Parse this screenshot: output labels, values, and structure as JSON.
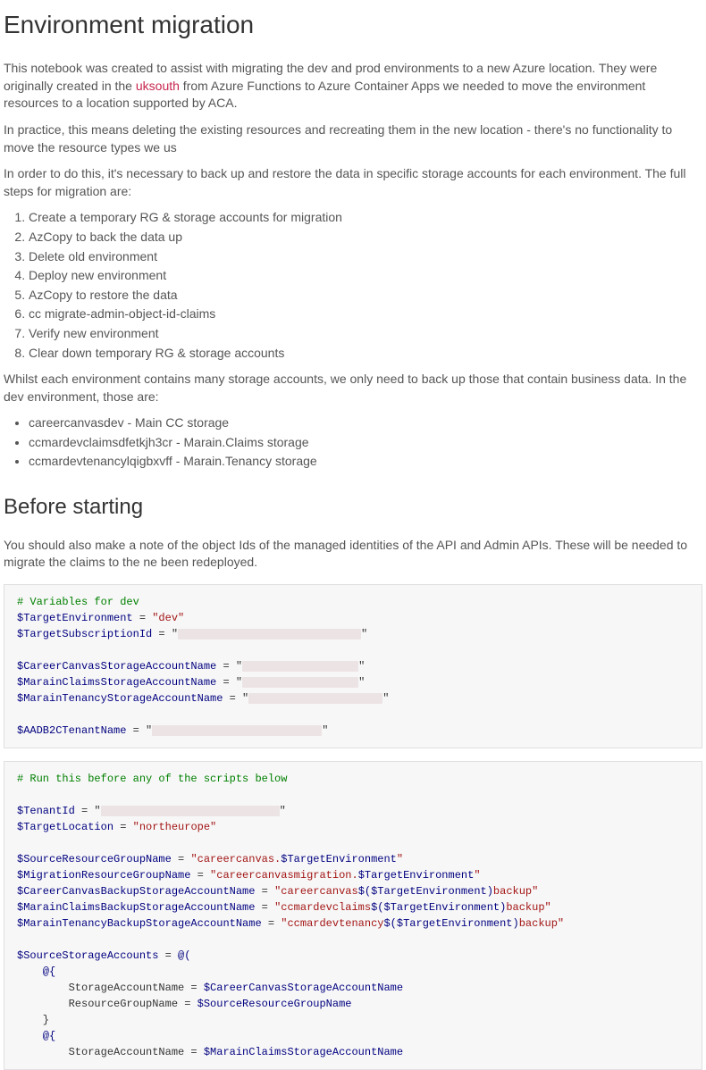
{
  "h1": "Environment migration",
  "p1_a": "This notebook was created to assist with migrating the dev and prod environments to a new Azure location. They were originally created in the ",
  "p1_region": "uksouth",
  "p1_b": " from Azure Functions to Azure Container Apps we needed to move the environment resources to a location supported by ACA.",
  "p2": "In practice, this means deleting the existing resources and recreating them in the new location - there's no functionality to move the resource types we us",
  "p3": "In order to do this, it's necessary to back up and restore the data in specific storage accounts for each environment. The full steps for migration are:",
  "steps": [
    "Create a temporary RG & storage accounts for migration",
    "AzCopy to back the data up",
    "Delete old environment",
    "Deploy new environment",
    "AzCopy to restore the data",
    "cc migrate-admin-object-id-claims",
    "Verify new environment",
    "Clear down temporary RG & storage accounts"
  ],
  "p4": "Whilst each environment contains many storage accounts, we only need to back up those that contain business data. In the dev environment, those are:",
  "accounts": [
    "careercanvasdev - Main CC storage",
    "ccmardevclaimsdfetkjh3cr - Marain.Claims storage",
    "ccmardevtenancylqigbxvff - Marain.Tenancy storage"
  ],
  "h2_before": "Before starting",
  "p5": "You should also make a note of the object Ids of the managed identities of the API and Admin APIs. These will be needed to migrate the claims to the ne been redeployed.",
  "code1": {
    "comment": "# Variables for dev",
    "l1a": "$TargetEnvironment",
    "l1b": " = ",
    "l1c": "\"dev\"",
    "l2a": "$TargetSubscriptionId",
    "l2b": " = \"",
    "l2c": "\"",
    "l3a": "$CareerCanvasStorageAccountName",
    "l3b": " = \"",
    "l3c": "\"",
    "l4a": "$MarainClaimsStorageAccountName",
    "l4b": " = \"",
    "l4c": "\"",
    "l5a": "$MarainTenancyStorageAccountName",
    "l5b": " = \"",
    "l5c": "\"",
    "l6a": "$AADB2CTenantName",
    "l6b": " = \"",
    "l6c": "\""
  },
  "code2": {
    "comment": "# Run this before any of the scripts below",
    "l1a": "$TenantId",
    "l1b": " = \"",
    "l1c": "\"",
    "l2a": "$TargetLocation",
    "l2b": " = ",
    "l2c": "\"northeurope\"",
    "l3a": "$SourceResourceGroupName",
    "l3b": " = ",
    "l3c": "\"careercanvas.",
    "l3d": "$TargetEnvironment",
    "l3e": "\"",
    "l4a": "$MigrationResourceGroupName",
    "l4b": " = ",
    "l4c": "\"careercanvasmigration.",
    "l4d": "$TargetEnvironment",
    "l4e": "\"",
    "l5a": "$CareerCanvasBackupStorageAccountName",
    "l5b": " = ",
    "l5c": "\"careercanvas",
    "l5d": "$(",
    "l5e": "$TargetEnvironment",
    "l5f": ")",
    "l5g": "backup\"",
    "l6a": "$MarainClaimsBackupStorageAccountName",
    "l6b": " = ",
    "l6c": "\"ccmardevclaims",
    "l6d": "$(",
    "l6e": "$TargetEnvironment",
    "l6f": ")",
    "l6g": "backup\"",
    "l7a": "$MarainTenancyBackupStorageAccountName",
    "l7b": " = ",
    "l7c": "\"ccmardevtenancy",
    "l7d": "$(",
    "l7e": "$TargetEnvironment",
    "l7f": ")",
    "l7g": "backup\"",
    "l8a": "$SourceStorageAccounts",
    "l8b": " = ",
    "l8c": "@(",
    "l9": "    @{",
    "l10a": "        StorageAccountName = ",
    "l10b": "$CareerCanvasStorageAccountName",
    "l11a": "        ResourceGroupName = ",
    "l11b": "$SourceResourceGroupName",
    "l12": "    }",
    "l13": "    @{",
    "l14a": "        StorageAccountName = ",
    "l14b": "$MarainClaimsStorageAccountName"
  }
}
